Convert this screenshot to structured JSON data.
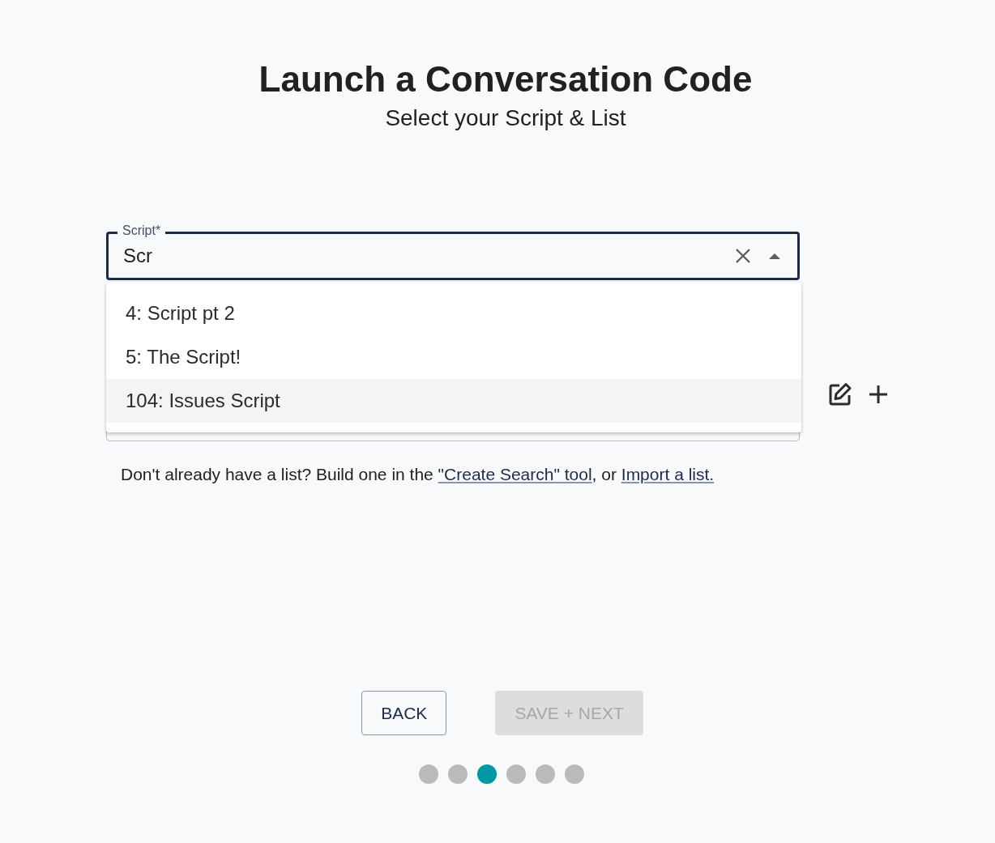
{
  "title": "Launch a Conversation Code",
  "subtitle": "Select your Script & List",
  "script_field": {
    "label": "Script*",
    "value": "Scr",
    "expanded": true
  },
  "dropdown_options": [
    {
      "label": "4: Script pt 2",
      "selected": false
    },
    {
      "label": "5: The Script!",
      "selected": false
    },
    {
      "label": "104: Issues Script",
      "selected": true
    }
  ],
  "help_text": {
    "before": "Don't already have a list? Build one in the ",
    "link_1": "\"Create Search\" tool",
    "middle": ", or ",
    "link_2": "Import a list."
  },
  "buttons": [
    {
      "label": "BACK",
      "disabled": false
    },
    {
      "label": "SAVE + NEXT",
      "disabled": true
    }
  ],
  "steps": [
    {
      "selected": false
    },
    {
      "selected": false
    },
    {
      "selected": true
    },
    {
      "selected": false
    },
    {
      "selected": false
    },
    {
      "selected": false
    }
  ]
}
